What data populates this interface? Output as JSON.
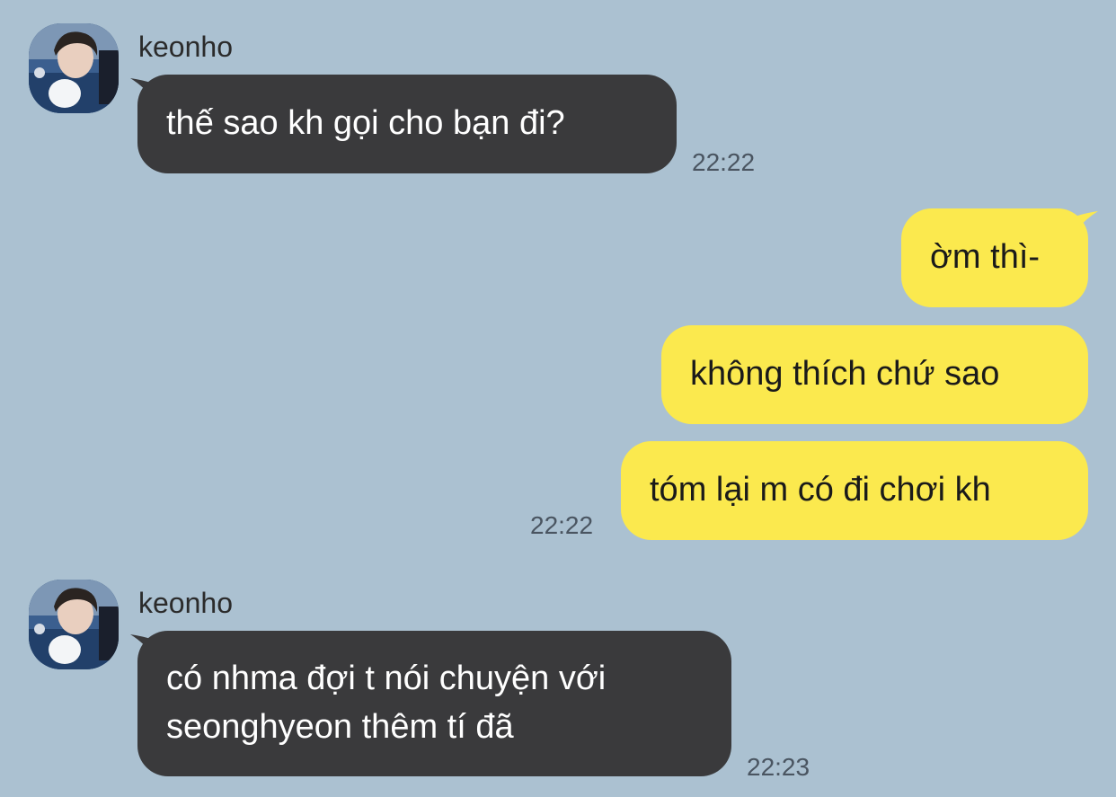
{
  "messages": [
    {
      "sender": "keonho",
      "text": "thế sao kh gọi cho bạn đi?",
      "time": "22:22"
    },
    {
      "text_1": "ờm thì-",
      "text_2": "không thích chứ sao",
      "text_3": "tóm lại m có đi chơi kh",
      "time": "22:22"
    },
    {
      "sender": "keonho",
      "text_line1": "có nhma đợi t nói chuyện với",
      "text_line2": "seonghyeon thêm tí đã",
      "time": "22:23"
    }
  ],
  "colors": {
    "background": "#ABC1D1",
    "incoming_bubble": "#3A3A3C",
    "outgoing_bubble": "#FBE94E"
  }
}
